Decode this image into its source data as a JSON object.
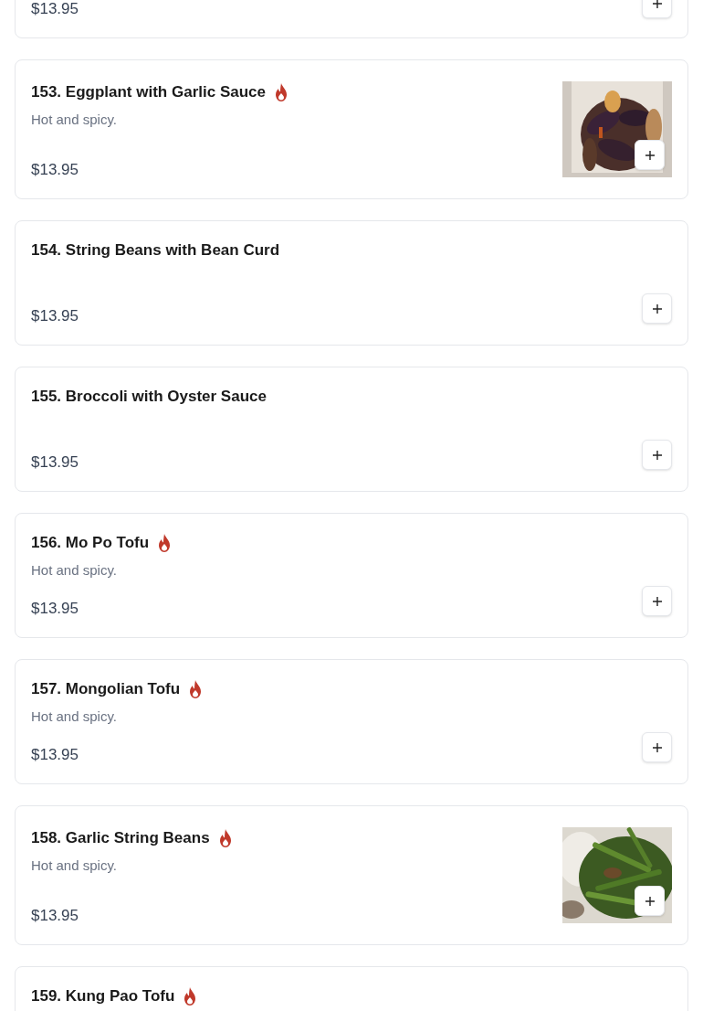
{
  "menu_items": [
    {
      "price": "$13.95"
    },
    {
      "name": "153. Eggplant with Garlic Sauce",
      "spicy": true,
      "description": "Hot and spicy.",
      "price": "$13.95"
    },
    {
      "name": "154. String Beans with Bean Curd",
      "spicy": false,
      "price": "$13.95"
    },
    {
      "name": "155. Broccoli with Oyster Sauce",
      "spicy": false,
      "price": "$13.95"
    },
    {
      "name": "156. Mo Po Tofu",
      "spicy": true,
      "description": "Hot and spicy.",
      "price": "$13.95"
    },
    {
      "name": "157. Mongolian Tofu",
      "spicy": true,
      "description": "Hot and spicy.",
      "price": "$13.95"
    },
    {
      "name": "158. Garlic String Beans",
      "spicy": true,
      "description": "Hot and spicy.",
      "price": "$13.95"
    },
    {
      "name": "159. Kung Pao Tofu",
      "spicy": true
    }
  ]
}
